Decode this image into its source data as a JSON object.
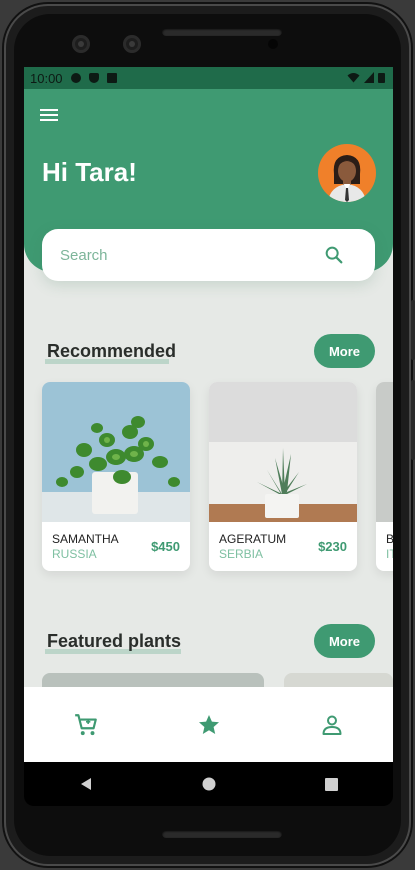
{
  "status_bar": {
    "time": "10:00"
  },
  "header": {
    "greeting": "Hi Tara!"
  },
  "search": {
    "placeholder": "Search"
  },
  "recommended": {
    "title": "Recommended",
    "more_label": "More",
    "items": [
      {
        "name": "SAMANTHA",
        "country": "RUSSIA",
        "price": "$450"
      },
      {
        "name": "AGERATUM",
        "country": "SERBIA",
        "price": "$230"
      },
      {
        "name": "B",
        "country": "IT",
        "price": ""
      }
    ]
  },
  "featured": {
    "title": "Featured plants",
    "more_label": "More"
  },
  "bottom_nav": {
    "items": [
      "cart-icon",
      "star-icon",
      "person-icon"
    ]
  },
  "colors": {
    "primary": "#3f9a72",
    "accent_light": "#7fc0a2",
    "avatar_bg": "#f0802a"
  }
}
